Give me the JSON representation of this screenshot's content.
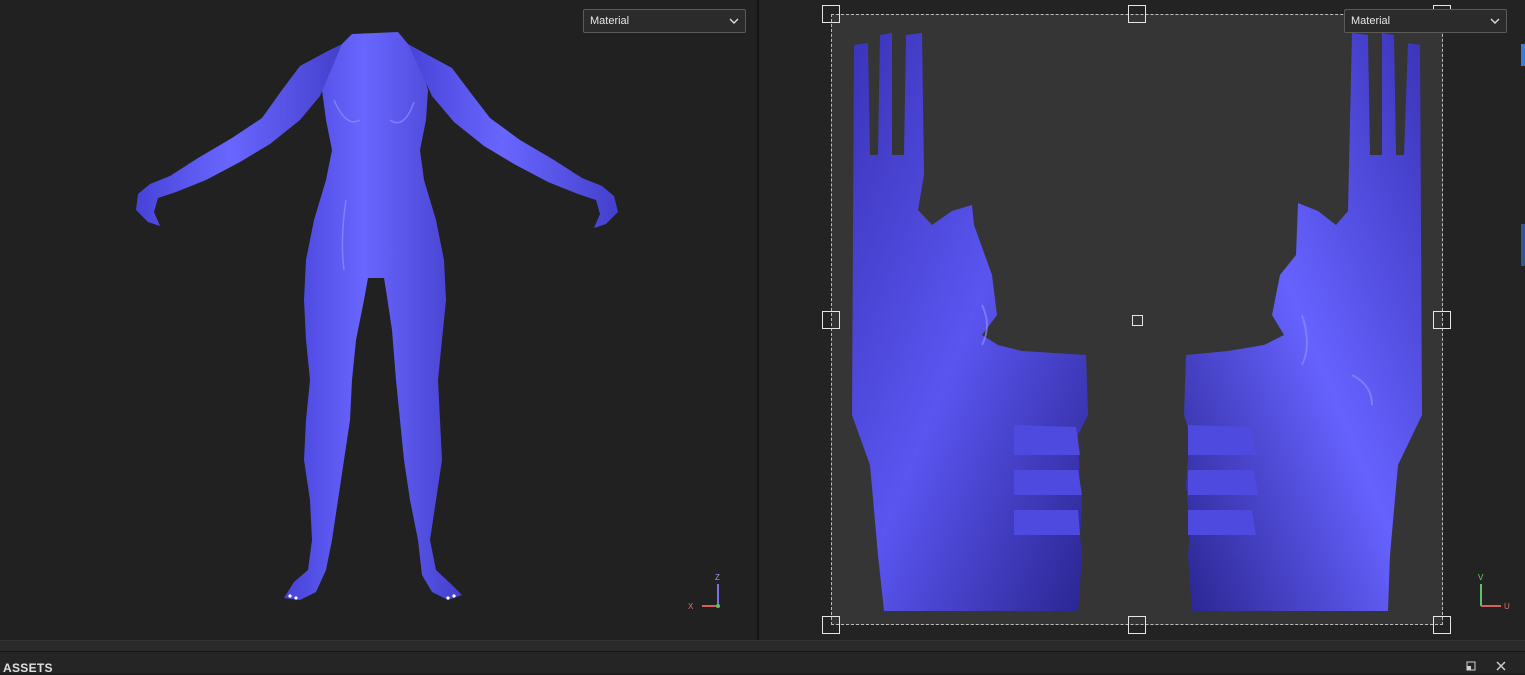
{
  "viewport_3d": {
    "shading_select": "Material",
    "axis": {
      "z": "Z",
      "x": "X"
    }
  },
  "viewport_uv": {
    "shading_select": "Material",
    "axis": {
      "v": "V",
      "u": "U"
    }
  },
  "assets_panel": {
    "title": "ASSETS"
  },
  "icons": [
    "chevron-down-icon",
    "maximize-icon",
    "close-icon",
    "axis-gizmo-icon"
  ],
  "colors": {
    "mesh": "#5a55f0",
    "viewport_bg": "#212121",
    "uv_sheet": "#353535",
    "accent": "#3a7bd5"
  }
}
